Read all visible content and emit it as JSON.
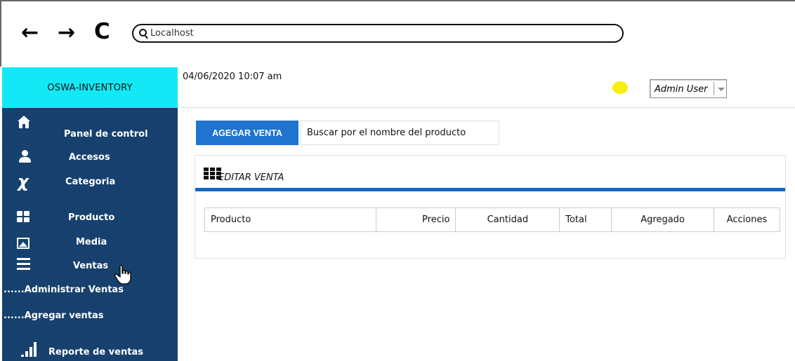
{
  "browser": {
    "back_icon": "arrow-left",
    "forward_icon": "arrow-right",
    "reload_icon": "reload",
    "address": "Localhost"
  },
  "brand": {
    "name": "OSWA-INVENTORY",
    "color": "#13e9f6"
  },
  "sidebar": {
    "background": "#143e6c",
    "items": [
      {
        "label": "Panel de control",
        "icon": "home-icon"
      },
      {
        "label": "Accesos",
        "icon": "user-icon"
      },
      {
        "label": "Categoria",
        "icon": "xing-icon"
      },
      {
        "label": "Producto",
        "icon": "grid-icon"
      },
      {
        "label": "Media",
        "icon": "image-icon"
      },
      {
        "label": "Ventas",
        "icon": "list-icon"
      },
      {
        "label": "......Administrar Ventas"
      },
      {
        "label": "......Agregar ventas"
      },
      {
        "label": "Reporte de ventas",
        "icon": "signal-bars-icon"
      }
    ]
  },
  "header": {
    "datetime": "04/06/2020 10:07 am",
    "status_color": "#f6ef09",
    "user": "Admin User"
  },
  "toolbar": {
    "add_sale_label": "AGEGAR VENTA",
    "search_text": "Buscar por el nombre del producto",
    "accent": "#1f74cf"
  },
  "panel": {
    "title": "EDITAR VENTA",
    "rule_color": "#1566c0",
    "columns": [
      "Producto",
      "Precio",
      "Cantidad",
      "Total",
      "Agregado",
      "Acciones"
    ]
  }
}
